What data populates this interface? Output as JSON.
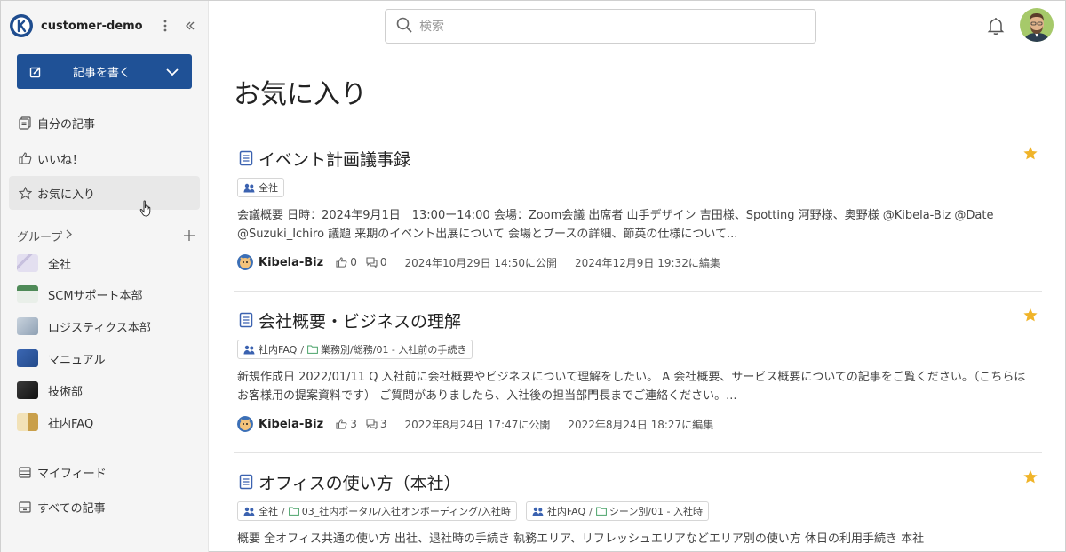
{
  "workspace": {
    "name": "customer-demo"
  },
  "sidebar": {
    "write_button": "記事を書く",
    "nav": [
      {
        "label": "自分の記事",
        "icon": "documents-icon"
      },
      {
        "label": "いいね！",
        "icon": "thumbs-up-icon"
      },
      {
        "label": "お気に入り",
        "icon": "star-outline-icon"
      }
    ],
    "groups_label": "グループ",
    "groups": [
      {
        "label": "全社",
        "color": "#d9d4e8"
      },
      {
        "label": "SCMサポート本部",
        "color": "#4f8a58"
      },
      {
        "label": "ロジスティクス本部",
        "color": "#a9b5c2"
      },
      {
        "label": "マニュアル",
        "color": "#3b67b3"
      },
      {
        "label": "技術部",
        "color": "#2b2b2b"
      },
      {
        "label": "社内FAQ",
        "color": "#c99f4a"
      }
    ],
    "bottom_nav": [
      {
        "label": "マイフィード",
        "icon": "feed-icon"
      },
      {
        "label": "すべての記事",
        "icon": "archive-icon"
      }
    ]
  },
  "search": {
    "placeholder": "検索"
  },
  "page": {
    "title": "お気に入り"
  },
  "articles": [
    {
      "title": "イベント計画議事録",
      "tags": [
        {
          "group": "全社",
          "folder": ""
        }
      ],
      "excerpt": "会議概要 日時：2024年9月1日　13:00ー14:00 会場：Zoom会議 出席者 山手デザイン 吉田様、Spotting 河野様、奥野様 @Kibela-Biz @Date @Suzuki_Ichiro 議題 来期のイベント出展について 会場とブースの詳細、節英の仕様について...",
      "author": "Kibela-Biz",
      "likes": "0",
      "comments": "0",
      "published": "2024年10月29日 14:50に公開",
      "edited": "2024年12月9日 19:32に編集"
    },
    {
      "title": "会社概要・ビジネスの理解",
      "tags": [
        {
          "group": "社内FAQ",
          "folder": "業務別/総務/01 - 入社前の手続き"
        }
      ],
      "excerpt": "新規作成日 2022/01/11 Q 入社前に会社概要やビジネスについて理解をしたい。 A 会社概要、サービス概要についての記事をご覧ください。（こちらはお客様用の提案資料です） ご質問がありましたら、入社後の担当部門長までご連絡ください。...",
      "author": "Kibela-Biz",
      "likes": "3",
      "comments": "3",
      "published": "2022年8月24日 17:47に公開",
      "edited": "2022年8月24日 18:27に編集"
    },
    {
      "title": "オフィスの使い方（本社）",
      "tags": [
        {
          "group": "全社",
          "folder": "03_社内ポータル/入社オンボーディング/入社時"
        },
        {
          "group": "社内FAQ",
          "folder": "シーン別/01 - 入社時"
        }
      ],
      "excerpt": "概要 全オフィス共通の使い方 出社、退社時の手続き 執務エリア、リフレッシュエリアなどエリア別の使い方 休日の利用手続き 本社",
      "author": "",
      "likes": "",
      "comments": "",
      "published": "",
      "edited": ""
    }
  ],
  "colors": {
    "primary": "#1f5196",
    "star": "#f0b429",
    "tag_icon": "#3b62b0"
  }
}
